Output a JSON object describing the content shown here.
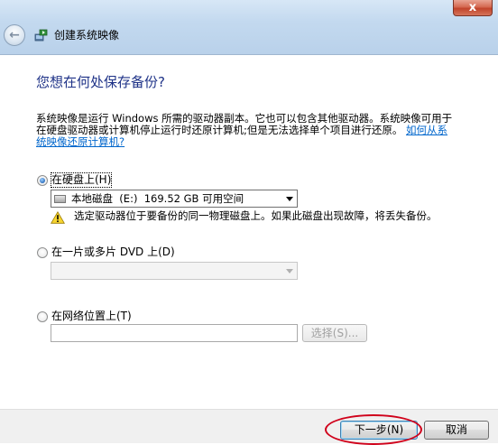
{
  "window": {
    "title": "创建系统映像",
    "close_glyph": "x",
    "back_glyph": "←"
  },
  "heading": "您想在何处保存备份?",
  "description": {
    "text": "系统映像是运行 Windows 所需的驱动器副本。它也可以包含其他驱动器。系统映像可用于在硬盘驱动器或计算机停止运行时还原计算机;但是无法选择单个项目进行还原。",
    "link": "如何从系统映像还原计算机?"
  },
  "options": {
    "hard_disk": {
      "label": "在硬盘上(H)",
      "selected": true,
      "combo_value": "本地磁盘  (E:)  169.52 GB 可用空间",
      "warning": "选定驱动器位于要备份的同一物理磁盘上。如果此磁盘出现故障，将丢失备份。"
    },
    "dvd": {
      "label": "在一片或多片 DVD 上(D)",
      "selected": false,
      "combo_value": ""
    },
    "network": {
      "label": "在网络位置上(T)",
      "selected": false,
      "path_value": "",
      "browse_label": "选择(S)..."
    }
  },
  "buttons": {
    "next": "下一步(N)",
    "cancel": "取消"
  },
  "colors": {
    "heading": "#1e3287",
    "link": "#0066cc",
    "annotation_circle": "#d0021b"
  }
}
